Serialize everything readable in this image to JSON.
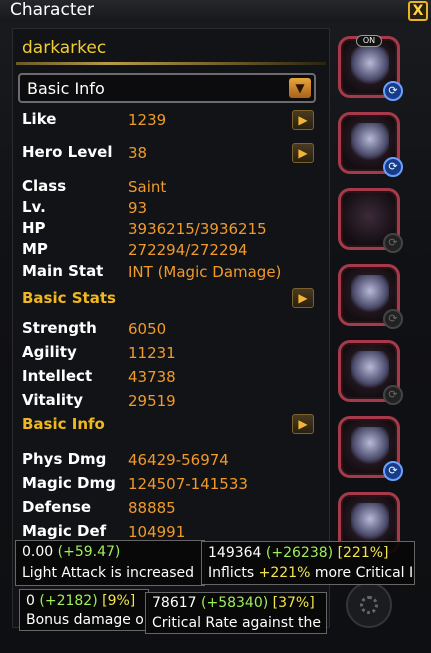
{
  "window": {
    "title": "Character",
    "close_label": "X"
  },
  "character": {
    "name": "darkarkec"
  },
  "dropdown": {
    "label": "Basic Info",
    "arrow": "▼"
  },
  "rows": {
    "like": {
      "label": "Like",
      "value": "1239"
    },
    "hero_level": {
      "label": "Hero Level",
      "value": "38"
    },
    "class": {
      "label": "Class",
      "value": "Saint"
    },
    "lv": {
      "label": "Lv.",
      "value": "93"
    },
    "hp": {
      "label": "HP",
      "value": "3936215/3936215"
    },
    "mp": {
      "label": "MP",
      "value": "272294/272294"
    },
    "main_stat": {
      "label": "Main Stat",
      "value": "INT (Magic Damage)"
    },
    "strength": {
      "label": "Strength",
      "value": "6050"
    },
    "agility": {
      "label": "Agility",
      "value": "11231"
    },
    "intellect": {
      "label": "Intellect",
      "value": "43738"
    },
    "vitality": {
      "label": "Vitality",
      "value": "29519"
    },
    "phys_dmg": {
      "label": "Phys Dmg",
      "value": "46429-56974"
    },
    "magic_dmg": {
      "label": "Magic Dmg",
      "value": "124507-141533"
    },
    "defense": {
      "label": "Defense",
      "value": "88885"
    },
    "magic_def": {
      "label": "Magic Def",
      "value": "104991"
    }
  },
  "sections": {
    "basic_stats": "Basic Stats",
    "basic_info": "Basic Info"
  },
  "arrow_glyph": "▶",
  "equip": {
    "on_tag": "ON",
    "swap_glyph": "⟳"
  },
  "tooltips": {
    "t1": {
      "base": "0.00",
      "bonus": "(+59.47)",
      "desc": "Light Attack is increased"
    },
    "t2": {
      "base": "149364",
      "bonus": "(+26238)",
      "pct": "[221%]",
      "desc_a": "Inflicts ",
      "desc_b": "+221%",
      "desc_c": " more Critical I"
    },
    "t3": {
      "base": "0",
      "bonus": "(+2182)",
      "pct": "[9%]",
      "desc": "Bonus damage o"
    },
    "t4": {
      "base": "78617",
      "bonus": "(+58340)",
      "pct": "[37%]",
      "desc": "Critical Rate against the"
    }
  },
  "colors": {
    "accent_gold": "#f1cd2f",
    "value_orange": "#f09a2a",
    "bonus_green": "#9ff05a",
    "slot_border": "#a63a4a"
  }
}
